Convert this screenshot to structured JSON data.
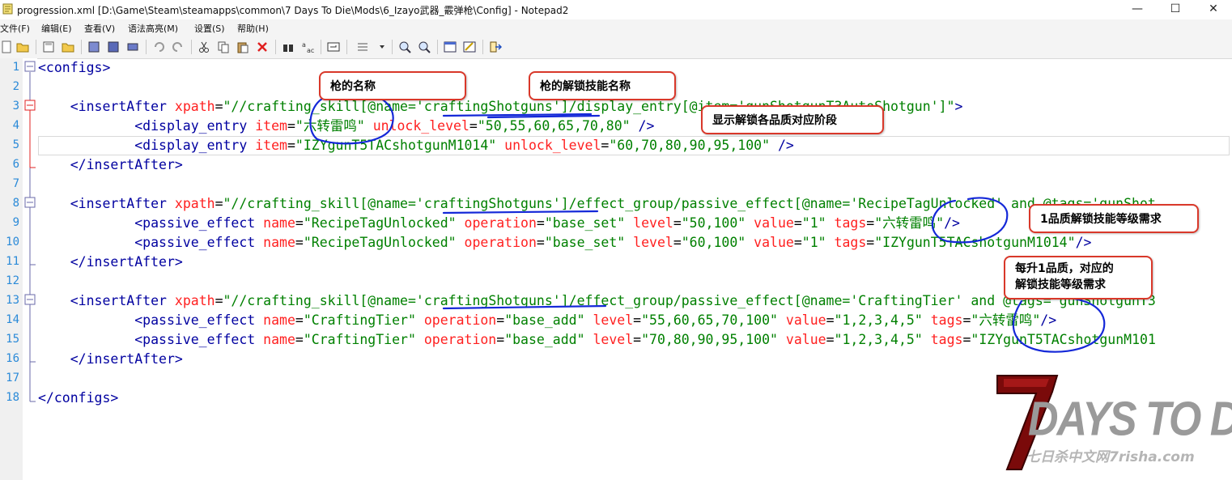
{
  "window": {
    "title": "progression.xml [D:\\Game\\Steam\\steamapps\\common\\7 Days To Die\\Mods\\6_Izayo武器_霰弹枪\\Config] - Notepad2",
    "minimize": "—",
    "maximize": "☐",
    "close": "✕"
  },
  "menu": [
    "文件(F)",
    "编辑(E)",
    "查看(V)",
    "语法高亮(M)",
    "设置(S)",
    "帮助(H)"
  ],
  "toolbar_icons": [
    "new-icon",
    "open-icon",
    "save-icon",
    "save-as-icon",
    "save-copy-icon",
    "undo-icon",
    "redo-icon",
    "cut-icon",
    "copy-icon",
    "paste-icon",
    "delete-icon",
    "find-icon",
    "replace-icon",
    "word-wrap-icon",
    "view-list-icon",
    "zoom-in-icon",
    "zoom-out-icon",
    "schemes-icon",
    "customize-icon",
    "exit-icon"
  ],
  "line_numbers": [
    "1",
    "2",
    "3",
    "4",
    "5",
    "6",
    "7",
    "8",
    "9",
    "10",
    "11",
    "12",
    "13",
    "14",
    "15",
    "16",
    "17",
    "18"
  ],
  "code": {
    "l1": {
      "a": "<configs>"
    },
    "l3": {
      "a": "    <insertAfter",
      "b": " xpath",
      "c": "=",
      "d": "\"//crafting_skill[@name='craftingShotguns']/display_entry[@item='gunShotgunT3AutoShotgun']\"",
      "e": ">"
    },
    "l4": {
      "a": "            <display_entry",
      "b": " item",
      "c": "=",
      "d": "\"六转雷鸣\"",
      "e": " unlock_level",
      "f": "=",
      "g": "\"50,55,60,65,70,80\"",
      "h": " />"
    },
    "l5": {
      "a": "            <display_entry",
      "b": " item",
      "c": "=",
      "d": "\"IZYgunT5TACshotgunM1014\"",
      "e": " unlock_level",
      "f": "=",
      "g": "\"60,70,80,90,95,100\"",
      "h": " />"
    },
    "l6": {
      "a": "    </insertAfter>"
    },
    "l8": {
      "a": "    <insertAfter",
      "b": " xpath",
      "c": "=",
      "d": "\"//crafting_skill[@name='craftingShotguns']/effect_group/passive_effect[@name='RecipeTagUnlocked' and @tags='gunShot"
    },
    "l9": {
      "a": "            <passive_effect",
      "b": " name",
      "c": "=",
      "d": "\"RecipeTagUnlocked\"",
      "e": " operation",
      "f": "=",
      "g": "\"base_set\"",
      "h": " level",
      "i": "=",
      "j": "\"50,100\"",
      "k": " value",
      "l": "=",
      "m": "\"1\"",
      "n": " tags",
      "o": "=",
      "p": "\"六转雷鸣\"",
      "q": "/>"
    },
    "l10": {
      "a": "            <passive_effect",
      "b": " name",
      "c": "=",
      "d": "\"RecipeTagUnlocked\"",
      "e": " operation",
      "f": "=",
      "g": "\"base_set\"",
      "h": " level",
      "i": "=",
      "j": "\"60,100\"",
      "k": " value",
      "l": "=",
      "m": "\"1\"",
      "n": " tags",
      "o": "=",
      "p": "\"IZYgunT5TACshotgunM1014\"",
      "q": "/>"
    },
    "l11": {
      "a": "    </insertAfter>"
    },
    "l13": {
      "a": "    <insertAfter",
      "b": " xpath",
      "c": "=",
      "d": "\"//crafting_skill[@name='craftingShotguns']/effect_group/passive_effect[@name='CraftingTier' and @tags='gunShotgunT3"
    },
    "l14": {
      "a": "            <passive_effect",
      "b": " name",
      "c": "=",
      "d": "\"CraftingTier\"",
      "e": " operation",
      "f": "=",
      "g": "\"base_add\"",
      "h": " level",
      "i": "=",
      "j": "\"55,60,65,70,100\"",
      "k": " value",
      "l": "=",
      "m": "\"1,2,3,4,5\"",
      "n": " tags",
      "o": "=",
      "p": "\"六转雷鸣\"",
      "q": "/>"
    },
    "l15": {
      "a": "            <passive_effect",
      "b": " name",
      "c": "=",
      "d": "\"CraftingTier\"",
      "e": " operation",
      "f": "=",
      "g": "\"base_add\"",
      "h": " level",
      "i": "=",
      "j": "\"70,80,90,95,100\"",
      "k": " value",
      "l": "=",
      "m": "\"1,2,3,4,5\"",
      "n": " tags",
      "o": "=",
      "p": "\"IZYgunT5TACshotgunM101"
    },
    "l16": {
      "a": "    </insertAfter>"
    },
    "l18": {
      "a": "</configs>"
    }
  },
  "annotations": {
    "gun_name": "枪的名称",
    "unlock_skill_name": "枪的解锁技能名称",
    "unlock_stages": "显示解锁各品质对应阶段",
    "tier1_requirement": "1品质解锁技能等级需求",
    "per_tier_requirement": "每升1品质，对应的\n解锁技能等级需求"
  },
  "logo": {
    "seven": "7",
    "text": "DAYS TO DIE",
    "subtitle": "七日杀中文网7risha.com"
  },
  "colors": {
    "tag": "#0000a0",
    "attribute": "#ff2020",
    "value": "#008000",
    "line_number": "#2b8ad8",
    "callout_border": "#d9382a",
    "ink_circle": "#1428d8"
  }
}
